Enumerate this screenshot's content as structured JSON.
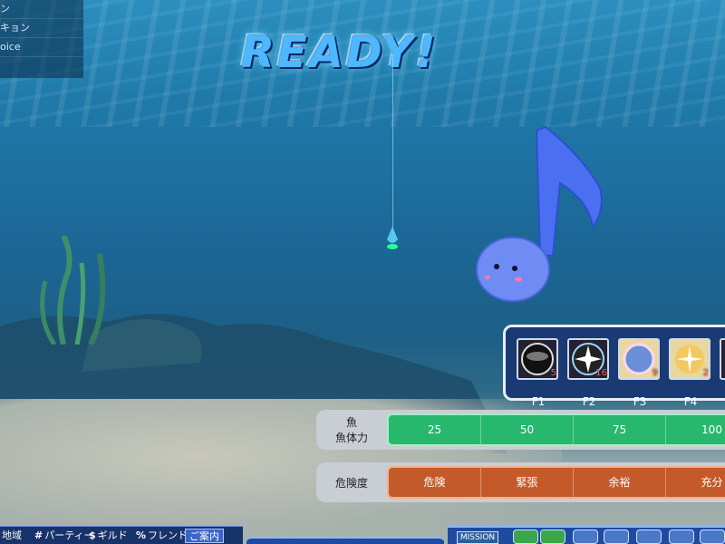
{
  "banner": {
    "text": "READY!"
  },
  "chat_channels": [
    "ン",
    "キョン",
    "oice"
  ],
  "skill_slots": [
    {
      "key": "F1",
      "count": "5",
      "icon": "dark-orb-icon"
    },
    {
      "key": "F2",
      "count": "16",
      "icon": "flash-orb-icon"
    },
    {
      "key": "F3",
      "count": "9",
      "icon": "bubble-orb-icon"
    },
    {
      "key": "F4",
      "count": "2",
      "icon": "sparkle-orb-icon"
    }
  ],
  "fish_gauge": {
    "label_line1": "魚",
    "label_line2": "魚体力",
    "ticks": [
      "25",
      "50",
      "75",
      "100"
    ]
  },
  "danger_gauge": {
    "label": "危険度",
    "ticks": [
      "危険",
      "緊張",
      "余裕",
      "充分"
    ]
  },
  "chat_tabs": [
    {
      "symbol": "",
      "label": "地域"
    },
    {
      "symbol": "#",
      "label": "パーティー"
    },
    {
      "symbol": "$",
      "label": "ギルド"
    },
    {
      "symbol": "%",
      "label": "フレンド"
    },
    {
      "symbol": "",
      "label": "ご案内"
    }
  ],
  "menu": {
    "mission_label": "MISSION"
  },
  "colors": {
    "fish_gauge": "#27b86e",
    "danger_gauge": "#c45a2a",
    "panel": "#1a3a74",
    "accent": "#4db7ff"
  }
}
